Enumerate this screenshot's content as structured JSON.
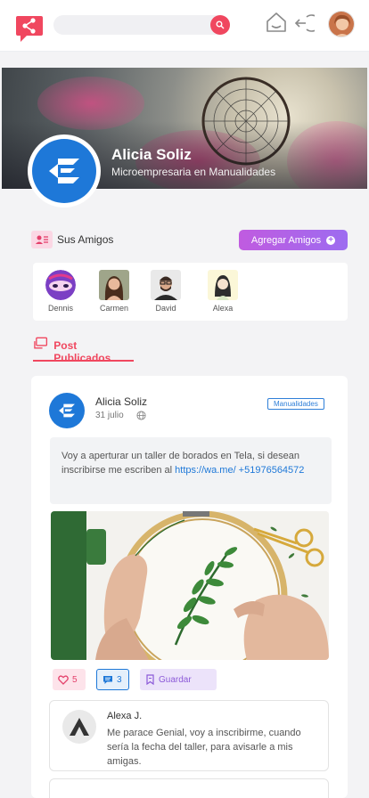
{
  "header": {
    "search_placeholder": "",
    "icons": {
      "logo": "chat-share-icon",
      "search": "search-icon",
      "home": "home-icon",
      "logout": "logout-icon"
    }
  },
  "profile": {
    "name": "Alicia Soliz",
    "role": "Microempresaria en Manualidades"
  },
  "friends": {
    "title": "Sus Amigos",
    "add_button": "Agregar Amigos",
    "list": [
      {
        "name": "Dennis"
      },
      {
        "name": "Carmen"
      },
      {
        "name": "David"
      },
      {
        "name": "Alexa"
      }
    ]
  },
  "tabs": {
    "posts_label": "Post Publicados"
  },
  "post": {
    "author": "Alicia Soliz",
    "date": "31 julio",
    "category": "Manualidades",
    "text_before_link": "Voy a aperturar un taller de borados en Tela, si desean inscribirse me escriben al ",
    "link": "https://wa.me/ +51976564572",
    "likes": "5",
    "comments": "3",
    "save_label": "Guardar"
  },
  "comment": {
    "author": "Alexa J.",
    "text": "Me parace Genial, voy a inscribirme, cuando sería la fecha del taller, para avisarle a mis amigas."
  },
  "colors": {
    "accent": "#f0475f",
    "blue": "#1e78d8",
    "purple": "#9d6cf0"
  }
}
